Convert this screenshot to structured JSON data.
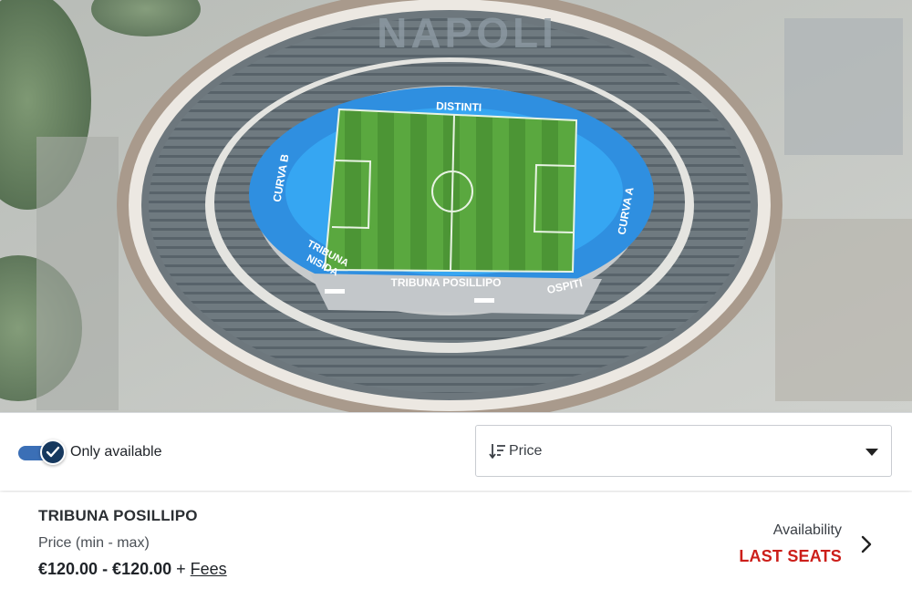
{
  "stadium_map": {
    "stand_labels": {
      "distinti": "DISTINTI",
      "curva_b": "CURVA B",
      "curva_a": "CURVA A",
      "tribuna_nisida_line1": "TRIBUNA",
      "tribuna_nisida_line2": "NISIDA",
      "tribuna_posillipo": "TRIBUNA POSILLIPO",
      "ospiti": "OSPITI"
    },
    "seat_text": "NAPOLI"
  },
  "filters": {
    "only_available_label": "Only available",
    "only_available_checked": true,
    "sort_label": "Price",
    "sort_icon": "sort-descending-icon"
  },
  "sectors": [
    {
      "name": "TRIBUNA POSILLIPO",
      "price_caption": "Price (min - max)",
      "price_range": "€120.00 - €120.00",
      "price_plus": " + ",
      "fees_label": "Fees",
      "availability_caption": "Availability",
      "availability_status": "LAST SEATS"
    }
  ],
  "colors": {
    "accent_blue": "#3b6fb6",
    "toggle_knob": "#16385e",
    "status_red": "#cc1f1a",
    "stand_blue": "#2f8fe0",
    "pitch_green": "#4f9a3a"
  }
}
